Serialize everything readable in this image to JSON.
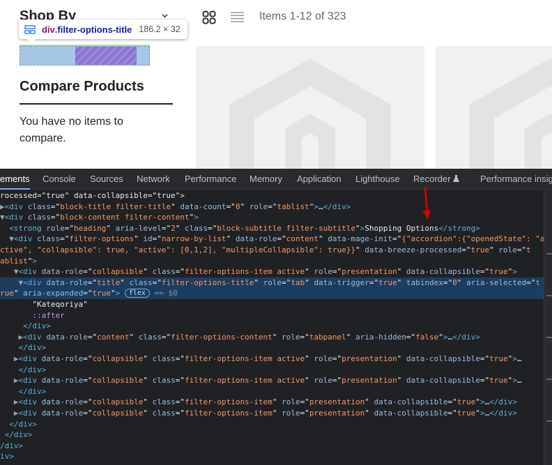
{
  "page": {
    "sidebar": {
      "shop_by": "Shop By",
      "compare_title": "Compare Products",
      "compare_text": "You have no items to compare."
    },
    "inspect_tooltip": {
      "tag": "div",
      "class_name": ".filter-options-title",
      "size": "186.2 × 32"
    },
    "toolbar": {
      "grid_icon": "grid-icon",
      "list_icon": "list-icon",
      "items_count": "Items 1-12 of 323"
    }
  },
  "devtools": {
    "tabs": [
      "ements",
      "Console",
      "Sources",
      "Network",
      "Performance",
      "Memory",
      "Application",
      "Lighthouse",
      "Recorder",
      "Performance insigh"
    ],
    "active_tab": "ements",
    "tree_lines": [
      {
        "segs": [
          [
            "tx",
            "rocessed=\"true\" data-collapsible=\"true\">"
          ]
        ]
      },
      {
        "segs": [
          [
            "tri",
            "▶"
          ],
          [
            "tg",
            "<div "
          ],
          [
            "an",
            "class"
          ],
          [
            "tx",
            "=\""
          ],
          [
            "av",
            "block-title filter-title"
          ],
          [
            "tx",
            "\" "
          ],
          [
            "an",
            "data-count"
          ],
          [
            "tx",
            "=\""
          ],
          [
            "av",
            "0"
          ],
          [
            "tx",
            "\" "
          ],
          [
            "an",
            "role"
          ],
          [
            "tx",
            "=\""
          ],
          [
            "av",
            "tablist"
          ],
          [
            "tx",
            "\""
          ],
          [
            "tg",
            ">"
          ],
          [
            "tx",
            "…"
          ],
          [
            "tg",
            "</div>"
          ]
        ]
      },
      {
        "segs": [
          [
            "tri",
            "▼"
          ],
          [
            "tg",
            "<div "
          ],
          [
            "an",
            "class"
          ],
          [
            "tx",
            "=\""
          ],
          [
            "av",
            "block-content filter-content"
          ],
          [
            "tx",
            "\""
          ],
          [
            "tg",
            ">"
          ]
        ]
      },
      {
        "segs": [
          [
            "tx",
            "  "
          ],
          [
            "tg",
            "<strong "
          ],
          [
            "an",
            "role"
          ],
          [
            "tx",
            "=\""
          ],
          [
            "av",
            "heading"
          ],
          [
            "tx",
            "\" "
          ],
          [
            "an",
            "aria-level"
          ],
          [
            "tx",
            "=\""
          ],
          [
            "av",
            "2"
          ],
          [
            "tx",
            "\" "
          ],
          [
            "an",
            "class"
          ],
          [
            "tx",
            "=\""
          ],
          [
            "av",
            "block-subtitle filter-subtitle"
          ],
          [
            "tx",
            "\""
          ],
          [
            "tg",
            ">"
          ],
          [
            "tx",
            "Shopping Options"
          ],
          [
            "tg",
            "</strong>"
          ]
        ]
      },
      {
        "segs": [
          [
            "tx",
            "  "
          ],
          [
            "tri",
            "▼"
          ],
          [
            "tg",
            "<div "
          ],
          [
            "an",
            "class"
          ],
          [
            "tx",
            "=\""
          ],
          [
            "av",
            "filter-options"
          ],
          [
            "tx",
            "\" "
          ],
          [
            "an",
            "id"
          ],
          [
            "tx",
            "=\""
          ],
          [
            "av",
            "narrow-by-list"
          ],
          [
            "tx",
            "\" "
          ],
          [
            "an",
            "data-role"
          ],
          [
            "tx",
            "=\""
          ],
          [
            "av",
            "content"
          ],
          [
            "tx",
            "\" "
          ],
          [
            "an",
            "data-mage-init"
          ],
          [
            "tx",
            "=\""
          ],
          [
            "av",
            "{\"accordion\":{\"openedState\": \"a"
          ]
        ]
      },
      {
        "segs": [
          [
            "av",
            "ctive\", \"collapsible\": true, \"active\": [0,1,2], \"multipleCollapsible\": true}}"
          ],
          [
            "tx",
            "\" "
          ],
          [
            "an",
            "data-breeze-processed"
          ],
          [
            "tx",
            "=\""
          ],
          [
            "av",
            "true"
          ],
          [
            "tx",
            "\" "
          ],
          [
            "an",
            "role"
          ],
          [
            "tx",
            "=\""
          ],
          [
            "av",
            "t"
          ]
        ]
      },
      {
        "segs": [
          [
            "av",
            "ablist"
          ],
          [
            "tx",
            "\""
          ],
          [
            "tg",
            ">"
          ]
        ]
      },
      {
        "segs": [
          [
            "tx",
            "   "
          ],
          [
            "tri",
            "▼"
          ],
          [
            "tg",
            "<div "
          ],
          [
            "an",
            "data-role"
          ],
          [
            "tx",
            "=\""
          ],
          [
            "av",
            "collapsible"
          ],
          [
            "tx",
            "\" "
          ],
          [
            "an",
            "class"
          ],
          [
            "tx",
            "=\""
          ],
          [
            "av",
            "filter-options-item active"
          ],
          [
            "tx",
            "\" "
          ],
          [
            "an",
            "role"
          ],
          [
            "tx",
            "=\""
          ],
          [
            "av",
            "presentation"
          ],
          [
            "tx",
            "\" "
          ],
          [
            "an",
            "data-collapsible"
          ],
          [
            "tx",
            "=\""
          ],
          [
            "av",
            "true"
          ],
          [
            "tx",
            "\""
          ],
          [
            "tg",
            ">"
          ]
        ]
      },
      {
        "selected": true,
        "segs": [
          [
            "tx",
            "    "
          ],
          [
            "tri",
            "▼"
          ],
          [
            "tg",
            "<div "
          ],
          [
            "an",
            "data-role"
          ],
          [
            "tx",
            "=\""
          ],
          [
            "av",
            "title"
          ],
          [
            "tx",
            "\" "
          ],
          [
            "an",
            "class"
          ],
          [
            "tx",
            "=\""
          ],
          [
            "av",
            "filter-options-title"
          ],
          [
            "tx",
            "\" "
          ],
          [
            "an",
            "role"
          ],
          [
            "tx",
            "=\""
          ],
          [
            "av",
            "tab"
          ],
          [
            "tx",
            "\" "
          ],
          [
            "an",
            "data-trigger"
          ],
          [
            "tx",
            "=\""
          ],
          [
            "av",
            "true"
          ],
          [
            "tx",
            "\" "
          ],
          [
            "an",
            "tabindex"
          ],
          [
            "tx",
            "=\""
          ],
          [
            "av",
            "0"
          ],
          [
            "tx",
            "\" "
          ],
          [
            "an",
            "aria-selected"
          ],
          [
            "tx",
            "=\""
          ],
          [
            "av",
            "t"
          ]
        ]
      },
      {
        "selected": true,
        "segs": [
          [
            "av",
            "rue"
          ],
          [
            "tx",
            "\" "
          ],
          [
            "an",
            "aria-expanded"
          ],
          [
            "tx",
            "=\""
          ],
          [
            "av",
            "true"
          ],
          [
            "tx",
            "\""
          ],
          [
            "tg",
            ">"
          ],
          [
            "tx",
            " "
          ],
          [
            "pill",
            "flex"
          ],
          [
            "dim",
            " == $0"
          ]
        ]
      },
      {
        "segs": [
          [
            "tx",
            "       \"Kateqoriya\""
          ]
        ]
      },
      {
        "segs": [
          [
            "tx",
            "       "
          ],
          [
            "ps",
            "::after"
          ]
        ]
      },
      {
        "segs": [
          [
            "tx",
            "     "
          ],
          [
            "tg",
            "</div>"
          ]
        ]
      },
      {
        "segs": [
          [
            "tx",
            "    "
          ],
          [
            "tri",
            "▶"
          ],
          [
            "tg",
            "<div "
          ],
          [
            "an",
            "data-role"
          ],
          [
            "tx",
            "=\""
          ],
          [
            "av",
            "content"
          ],
          [
            "tx",
            "\" "
          ],
          [
            "an",
            "class"
          ],
          [
            "tx",
            "=\""
          ],
          [
            "av",
            "filter-options-content"
          ],
          [
            "tx",
            "\" "
          ],
          [
            "an",
            "role"
          ],
          [
            "tx",
            "=\""
          ],
          [
            "av",
            "tabpanel"
          ],
          [
            "tx",
            "\" "
          ],
          [
            "an",
            "aria-hidden"
          ],
          [
            "tx",
            "=\""
          ],
          [
            "av",
            "false"
          ],
          [
            "tx",
            "\""
          ],
          [
            "tg",
            ">"
          ],
          [
            "tx",
            "…"
          ],
          [
            "tg",
            "</div>"
          ]
        ]
      },
      {
        "segs": [
          [
            "tx",
            "    "
          ],
          [
            "tg",
            "</div>"
          ]
        ]
      },
      {
        "segs": [
          [
            "tx",
            "   "
          ],
          [
            "tri",
            "▶"
          ],
          [
            "tg",
            "<div "
          ],
          [
            "an",
            "data-role"
          ],
          [
            "tx",
            "=\""
          ],
          [
            "av",
            "collapsible"
          ],
          [
            "tx",
            "\" "
          ],
          [
            "an",
            "class"
          ],
          [
            "tx",
            "=\""
          ],
          [
            "av",
            "filter-options-item active"
          ],
          [
            "tx",
            "\" "
          ],
          [
            "an",
            "role"
          ],
          [
            "tx",
            "=\""
          ],
          [
            "av",
            "presentation"
          ],
          [
            "tx",
            "\" "
          ],
          [
            "an",
            "data-collapsible"
          ],
          [
            "tx",
            "=\""
          ],
          [
            "av",
            "true"
          ],
          [
            "tx",
            "\""
          ],
          [
            "tg",
            ">"
          ],
          [
            "tx",
            "…"
          ]
        ]
      },
      {
        "segs": [
          [
            "tx",
            "    "
          ],
          [
            "tg",
            "</div>"
          ]
        ]
      },
      {
        "segs": [
          [
            "tx",
            "   "
          ],
          [
            "tri",
            "▶"
          ],
          [
            "tg",
            "<div "
          ],
          [
            "an",
            "data-role"
          ],
          [
            "tx",
            "=\""
          ],
          [
            "av",
            "collapsible"
          ],
          [
            "tx",
            "\" "
          ],
          [
            "an",
            "class"
          ],
          [
            "tx",
            "=\""
          ],
          [
            "av",
            "filter-options-item active"
          ],
          [
            "tx",
            "\" "
          ],
          [
            "an",
            "role"
          ],
          [
            "tx",
            "=\""
          ],
          [
            "av",
            "presentation"
          ],
          [
            "tx",
            "\" "
          ],
          [
            "an",
            "data-collapsible"
          ],
          [
            "tx",
            "=\""
          ],
          [
            "av",
            "true"
          ],
          [
            "tx",
            "\""
          ],
          [
            "tg",
            ">"
          ],
          [
            "tx",
            "…"
          ]
        ]
      },
      {
        "segs": [
          [
            "tx",
            "    "
          ],
          [
            "tg",
            "</div>"
          ]
        ]
      },
      {
        "segs": [
          [
            "tx",
            "   "
          ],
          [
            "tri",
            "▶"
          ],
          [
            "tg",
            "<div "
          ],
          [
            "an",
            "data-role"
          ],
          [
            "tx",
            "=\""
          ],
          [
            "av",
            "collapsible"
          ],
          [
            "tx",
            "\" "
          ],
          [
            "an",
            "class"
          ],
          [
            "tx",
            "=\""
          ],
          [
            "av",
            "filter-options-item"
          ],
          [
            "tx",
            "\" "
          ],
          [
            "an",
            "role"
          ],
          [
            "tx",
            "=\""
          ],
          [
            "av",
            "presentation"
          ],
          [
            "tx",
            "\" "
          ],
          [
            "an",
            "data-collapsible"
          ],
          [
            "tx",
            "=\""
          ],
          [
            "av",
            "true"
          ],
          [
            "tx",
            "\""
          ],
          [
            "tg",
            ">"
          ],
          [
            "tx",
            "…"
          ],
          [
            "tg",
            "</div>"
          ]
        ]
      },
      {
        "segs": [
          [
            "tx",
            "   "
          ],
          [
            "tri",
            "▶"
          ],
          [
            "tg",
            "<div "
          ],
          [
            "an",
            "data-role"
          ],
          [
            "tx",
            "=\""
          ],
          [
            "av",
            "collapsible"
          ],
          [
            "tx",
            "\" "
          ],
          [
            "an",
            "class"
          ],
          [
            "tx",
            "=\""
          ],
          [
            "av",
            "filter-options-item"
          ],
          [
            "tx",
            "\" "
          ],
          [
            "an",
            "role"
          ],
          [
            "tx",
            "=\""
          ],
          [
            "av",
            "presentation"
          ],
          [
            "tx",
            "\" "
          ],
          [
            "an",
            "data-collapsible"
          ],
          [
            "tx",
            "=\""
          ],
          [
            "av",
            "true"
          ],
          [
            "tx",
            "\""
          ],
          [
            "tg",
            ">"
          ],
          [
            "tx",
            "…"
          ],
          [
            "tg",
            "</div>"
          ]
        ]
      },
      {
        "segs": [
          [
            "tx",
            "  "
          ],
          [
            "tg",
            "</div>"
          ]
        ]
      },
      {
        "segs": [
          [
            "tx",
            " "
          ],
          [
            "tg",
            "</div>"
          ]
        ]
      },
      {
        "segs": [
          [
            "tg",
            "/div>"
          ]
        ]
      },
      {
        "segs": [
          [
            "tg",
            "iv>"
          ]
        ]
      }
    ]
  }
}
